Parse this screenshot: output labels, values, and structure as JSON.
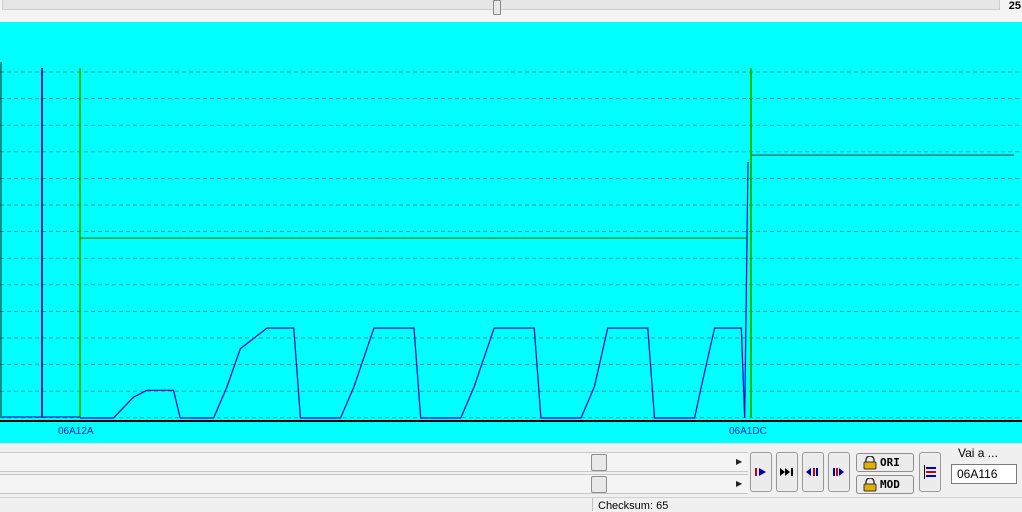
{
  "top_slider": {
    "value": "25",
    "position": 0.495
  },
  "chart_data": {
    "type": "line",
    "x_markers": [
      "06A12A",
      "06A1DC"
    ],
    "grid": "horizontal dashed",
    "background": "#00ffff",
    "series": [
      {
        "color": "#0000cc",
        "points": [
          [
            0,
            0
          ],
          [
            0.05,
            0
          ],
          [
            0.08,
            0.06
          ],
          [
            0.1,
            0.08
          ],
          [
            0.14,
            0.08
          ],
          [
            0.15,
            0
          ],
          [
            0.2,
            0
          ],
          [
            0.22,
            0.09
          ],
          [
            0.24,
            0.2
          ],
          [
            0.28,
            0.26
          ],
          [
            0.32,
            0.26
          ],
          [
            0.33,
            0
          ],
          [
            0.39,
            0
          ],
          [
            0.41,
            0.09
          ],
          [
            0.44,
            0.26
          ],
          [
            0.46,
            0.26
          ],
          [
            0.5,
            0.26
          ],
          [
            0.51,
            0
          ],
          [
            0.57,
            0
          ],
          [
            0.59,
            0.09
          ],
          [
            0.62,
            0.26
          ],
          [
            0.65,
            0.26
          ],
          [
            0.68,
            0.26
          ],
          [
            0.69,
            0
          ],
          [
            0.75,
            0
          ],
          [
            0.77,
            0.09
          ],
          [
            0.79,
            0.26
          ],
          [
            0.83,
            0.26
          ],
          [
            0.85,
            0.26
          ],
          [
            0.86,
            0
          ],
          [
            0.92,
            0
          ],
          [
            0.93,
            0.09
          ],
          [
            0.95,
            0.26
          ],
          [
            0.99,
            0.26
          ],
          [
            0.995,
            0
          ],
          [
            1.0,
            0.74
          ]
        ]
      },
      {
        "color": "#008000",
        "level": 0.52
      },
      {
        "color": "#505050",
        "level": 0.76
      }
    ]
  },
  "bottom_bar": {
    "slider1": {
      "position": 0.5
    },
    "slider2": {
      "position": 0.5
    },
    "nav_buttons": [
      "play-forward",
      "skip-forward",
      "step-back-marker",
      "step-forward-marker"
    ],
    "ori_label": "ORI",
    "mod_label": "MOD",
    "goto_label": "Vai a ...",
    "goto_value": "06A116"
  },
  "status": {
    "checksum": "Checksum: 65"
  }
}
